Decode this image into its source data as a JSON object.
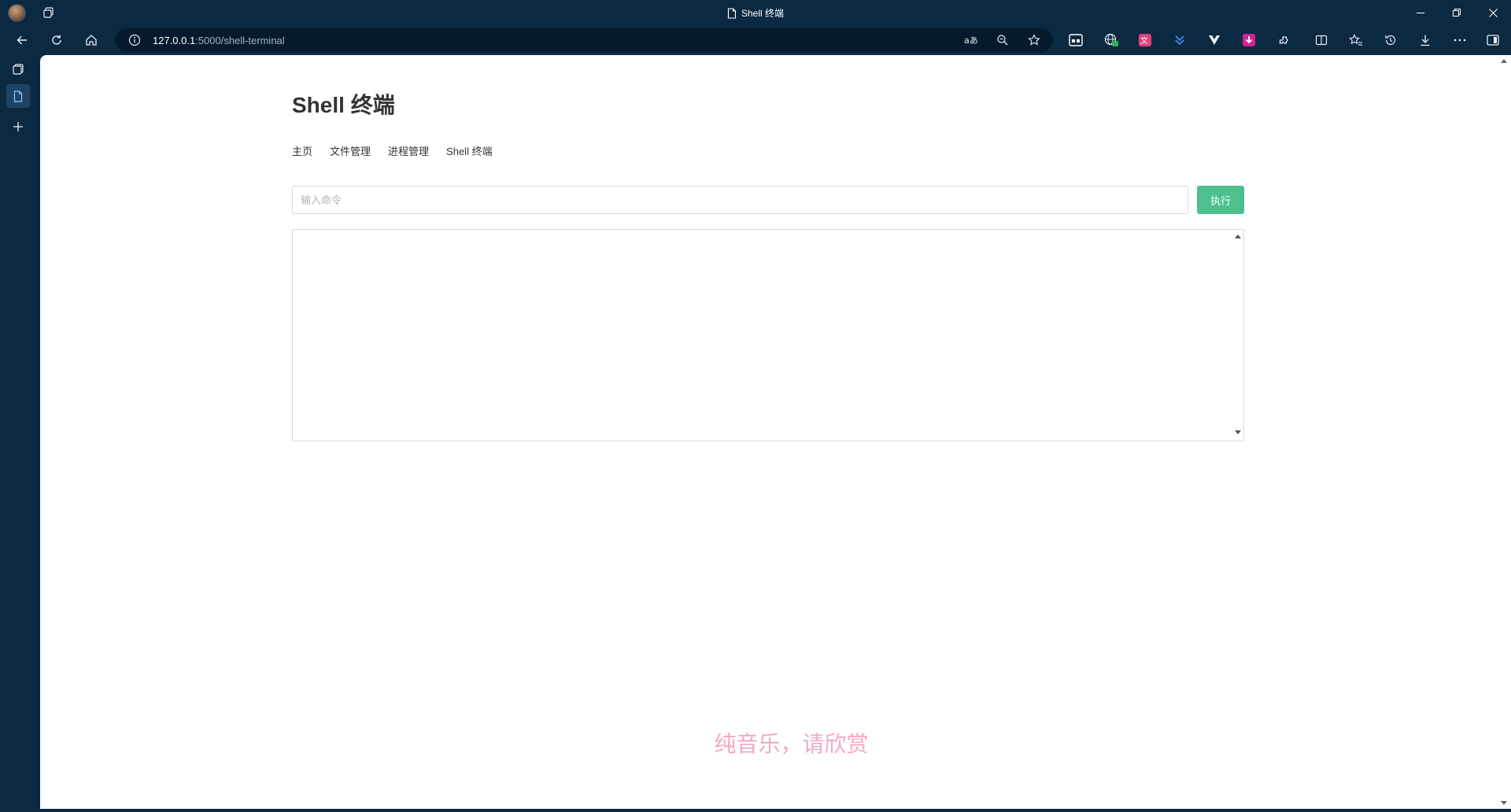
{
  "browser": {
    "tab_title": "Shell 终端",
    "url_host": "127.0.0.1",
    "url_rest": ":5000/shell-terminal"
  },
  "page": {
    "title": "Shell 终端",
    "nav": [
      "主页",
      "文件管理",
      "进程管理",
      "Shell 终端"
    ],
    "command_placeholder": "输入命令",
    "command_value": "",
    "execute_label": "执行",
    "output_text": "",
    "footer_text": "纯音乐，请欣赏"
  },
  "colors": {
    "chrome_bg": "#0c2942",
    "accent_button": "#4ec08e",
    "footer_text": "#f3a8c6"
  }
}
